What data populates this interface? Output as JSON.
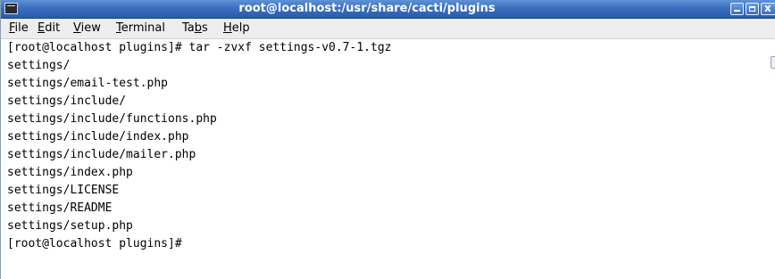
{
  "window": {
    "title": "root@localhost:/usr/share/cacti/plugins"
  },
  "menu": {
    "items": [
      {
        "pre": "",
        "ul": "F",
        "post": "ile"
      },
      {
        "pre": "",
        "ul": "E",
        "post": "dit"
      },
      {
        "pre": "",
        "ul": "V",
        "post": "iew"
      },
      {
        "pre": "",
        "ul": "T",
        "post": "erminal"
      },
      {
        "pre": "Ta",
        "ul": "b",
        "post": "s"
      },
      {
        "pre": "",
        "ul": "H",
        "post": "elp"
      }
    ]
  },
  "terminal": {
    "lines": [
      "[root@localhost plugins]# tar -zvxf settings-v0.7-1.tgz",
      "settings/",
      "settings/email-test.php",
      "settings/include/",
      "settings/include/functions.php",
      "settings/include/index.php",
      "settings/include/mailer.php",
      "settings/index.php",
      "settings/LICENSE",
      "settings/README",
      "settings/setup.php",
      "[root@localhost plugins]#"
    ]
  },
  "icons": {
    "app": "terminal-icon",
    "minimize": "minimize-icon",
    "maximize": "maximize-icon",
    "close": "close-icon"
  }
}
